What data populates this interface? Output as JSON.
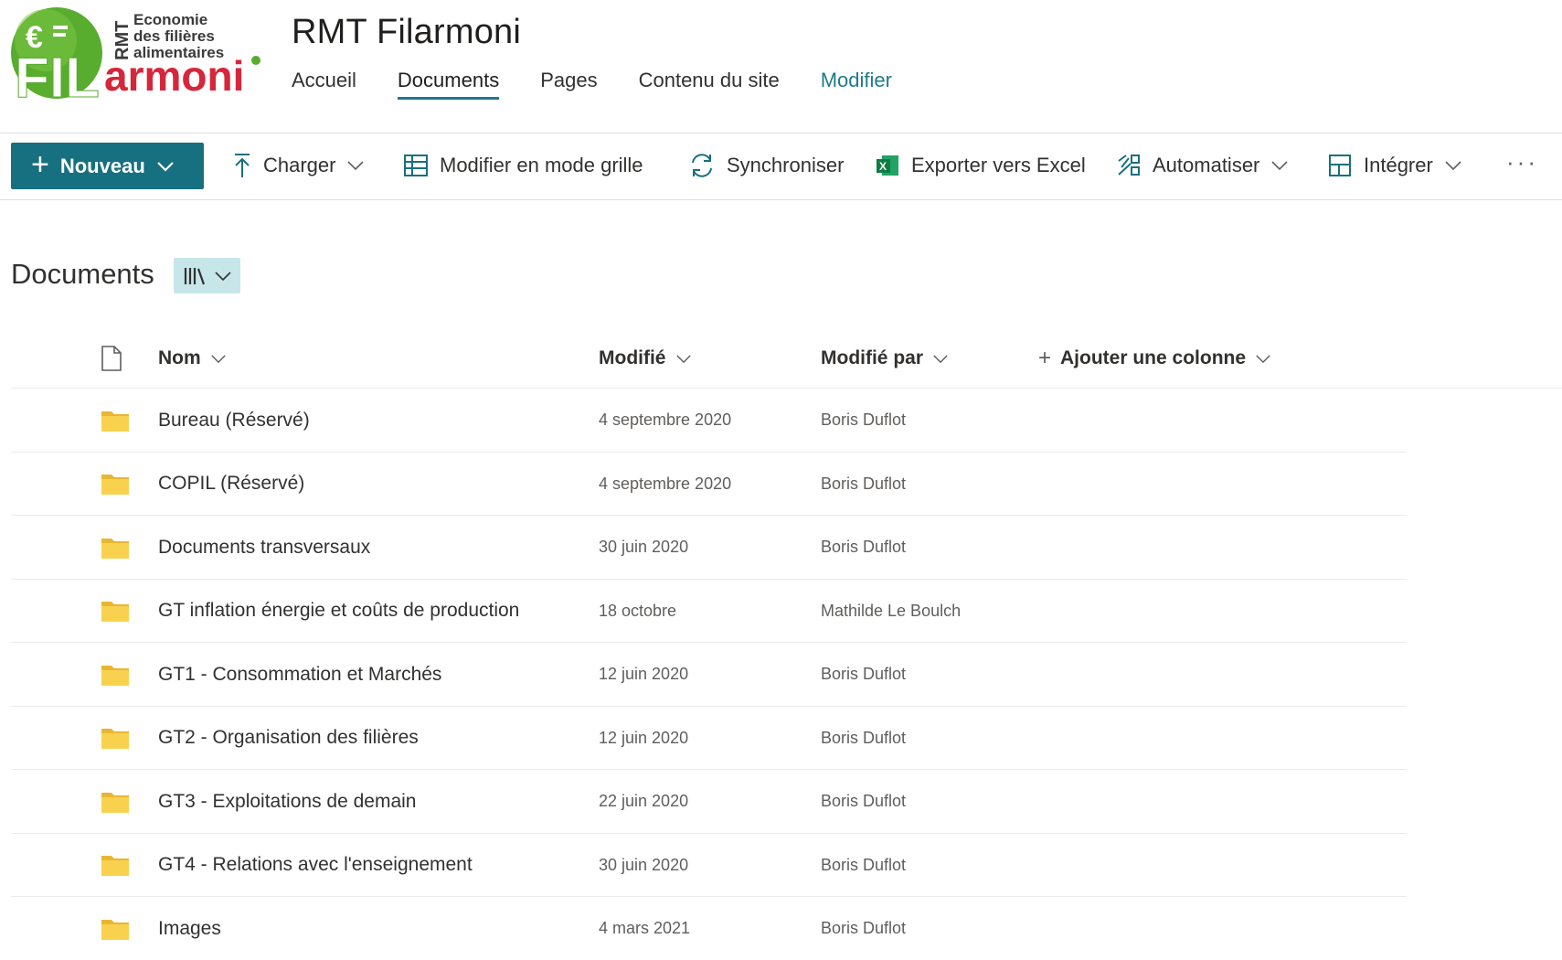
{
  "site": {
    "logo": {
      "line1": "Economie",
      "line2": "des filières",
      "line3": "alimentaires",
      "vertical": "RMT",
      "big_green": "FIL",
      "big_red": "armoni",
      "euro": "€"
    },
    "title": "RMT Filarmoni",
    "nav": [
      {
        "label": "Accueil"
      },
      {
        "label": "Documents"
      },
      {
        "label": "Pages"
      },
      {
        "label": "Contenu du site"
      },
      {
        "label": "Modifier"
      }
    ],
    "active_nav": "Documents"
  },
  "commandbar": {
    "new_label": "Nouveau",
    "upload_label": "Charger",
    "grid_label": "Modifier en mode grille",
    "sync_label": "Synchroniser",
    "excel_label": "Exporter vers Excel",
    "automate_label": "Automatiser",
    "integrate_label": "Intégrer",
    "more_label": "···"
  },
  "library": {
    "title": "Documents",
    "view_icon": "library-icon"
  },
  "list": {
    "columns": {
      "name": "Nom",
      "modified": "Modifié",
      "modified_by": "Modifié par",
      "add_column": "Ajouter une colonne"
    },
    "rows": [
      {
        "name": "Bureau (Réservé)",
        "modified": "4 septembre 2020",
        "modified_by": "Boris Duflot"
      },
      {
        "name": "COPIL (Réservé)",
        "modified": "4 septembre 2020",
        "modified_by": "Boris Duflot"
      },
      {
        "name": "Documents transversaux",
        "modified": "30 juin 2020",
        "modified_by": "Boris Duflot"
      },
      {
        "name": "GT inflation énergie et coûts de production",
        "modified": "18 octobre",
        "modified_by": "Mathilde Le Boulch"
      },
      {
        "name": "GT1 - Consommation et Marchés",
        "modified": "12 juin 2020",
        "modified_by": "Boris Duflot"
      },
      {
        "name": "GT2 - Organisation des filières",
        "modified": "12 juin 2020",
        "modified_by": "Boris Duflot"
      },
      {
        "name": "GT3 - Exploitations de demain",
        "modified": "22 juin 2020",
        "modified_by": "Boris Duflot"
      },
      {
        "name": "GT4 - Relations avec l'enseignement",
        "modified": "30 juin 2020",
        "modified_by": "Boris Duflot"
      },
      {
        "name": "Images",
        "modified": "4 mars 2021",
        "modified_by": "Boris Duflot"
      }
    ]
  },
  "colors": {
    "accent": "#17707f",
    "nav_active_underline": "#1f7a8c",
    "folder": "#f8d24f",
    "logo_green": "#58ad2e",
    "logo_red": "#d5263b"
  }
}
